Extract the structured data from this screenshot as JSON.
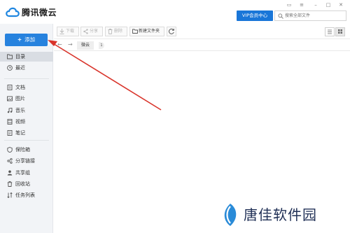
{
  "app": {
    "title": "腾讯微云"
  },
  "header": {
    "vip_label": "VIP会员中心",
    "search_placeholder": "搜索全部文件"
  },
  "sidebar": {
    "add_label": "添加",
    "groups": [
      [
        {
          "label": "目录",
          "icon": "folder-icon",
          "active": true
        },
        {
          "label": "最近",
          "icon": "clock-icon"
        }
      ],
      [
        {
          "label": "文档",
          "icon": "document-icon"
        },
        {
          "label": "图片",
          "icon": "image-icon"
        },
        {
          "label": "音乐",
          "icon": "music-icon"
        },
        {
          "label": "视频",
          "icon": "video-icon"
        },
        {
          "label": "笔记",
          "icon": "note-icon"
        }
      ],
      [
        {
          "label": "保险箱",
          "icon": "safe-icon"
        },
        {
          "label": "分享链接",
          "icon": "share-link-icon"
        },
        {
          "label": "共享组",
          "icon": "group-icon"
        },
        {
          "label": "回收站",
          "icon": "trash-icon"
        },
        {
          "label": "任务列表",
          "icon": "task-list-icon"
        }
      ]
    ]
  },
  "toolbar": {
    "download_label": "下载",
    "share_label": "分享",
    "delete_label": "删除",
    "new_folder_label": "新建文件夹"
  },
  "breadcrumb": {
    "current": "微云",
    "count": "1"
  },
  "watermark": {
    "text": "唐佳软件园"
  },
  "colors": {
    "accent": "#2682de",
    "vip": "#1976d8",
    "arrow": "#d9342b"
  }
}
